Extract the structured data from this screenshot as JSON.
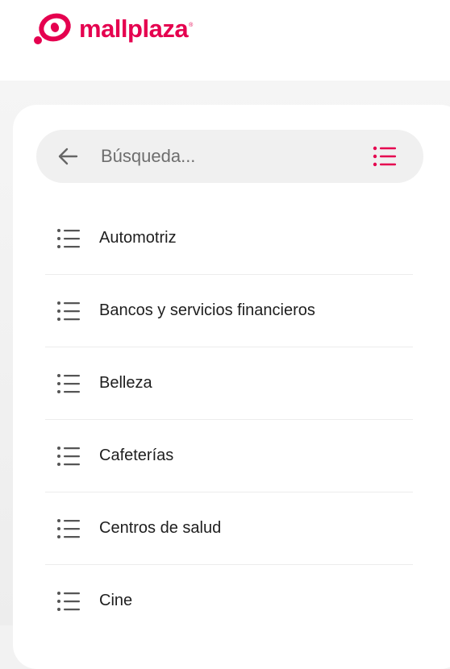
{
  "header": {
    "brand_name": "mallplaza",
    "brand_registered": "®",
    "brand_color": "#e5004f"
  },
  "search": {
    "placeholder": "Búsqueda...",
    "value": "",
    "back_icon": "arrow-left-icon",
    "toggle_icon": "list-icon",
    "toggle_color": "#e5004f"
  },
  "categories": [
    {
      "label": "Automotriz",
      "icon": "list-icon"
    },
    {
      "label": "Bancos y servicios financieros",
      "icon": "list-icon"
    },
    {
      "label": "Belleza",
      "icon": "list-icon"
    },
    {
      "label": "Cafeterías",
      "icon": "list-icon"
    },
    {
      "label": "Centros de salud",
      "icon": "list-icon"
    },
    {
      "label": "Cine",
      "icon": "list-icon"
    }
  ]
}
